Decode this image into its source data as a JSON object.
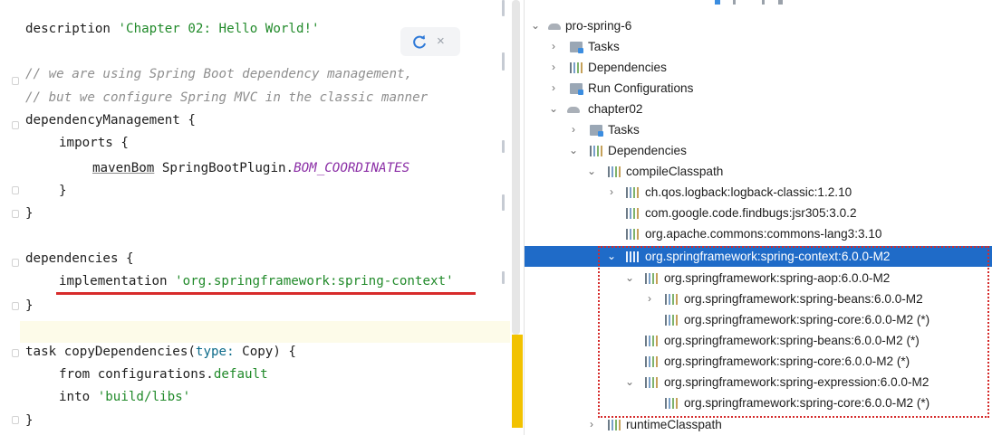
{
  "editor": {
    "lines": {
      "l1": {
        "kw": "description",
        "str": "'Chapter 02: Hello World!'"
      },
      "l3": "// we are using Spring Boot dependency management,",
      "l4": "// but we configure Spring MVC in the classic manner",
      "l5": {
        "a": "dependencyManagement",
        "b": " {"
      },
      "l6": {
        "a": "imports",
        "b": " {"
      },
      "l7": {
        "a": "mavenBom",
        "b": " SpringBootPlugin.",
        "c": "BOM_COORDINATES"
      },
      "l8": "}",
      "l9": "}",
      "l11": {
        "a": "dependencies",
        "b": " {"
      },
      "l12": {
        "a": "implementation",
        "b": " ",
        "c": "'org.springframework:spring-context'"
      },
      "l13": "}",
      "l15": {
        "a": "task",
        "b": " copyDependencies(",
        "c": "type:",
        "d": " Copy) {"
      },
      "l16": {
        "a": "from",
        "b": " configurations.",
        "c": "default"
      },
      "l17": {
        "a": "into",
        "b": " ",
        "c": "'build/libs'"
      },
      "l18": "}"
    },
    "reload_icon": "reload-icon",
    "close_label": "×"
  },
  "tree": {
    "rows": [
      {
        "label": "pro-spring-6",
        "icon": "project-icon"
      },
      {
        "label": "Tasks",
        "icon": "tasks-folder-icon"
      },
      {
        "label": "Dependencies",
        "icon": "dependencies-icon"
      },
      {
        "label": "Run Configurations",
        "icon": "run-configurations-icon"
      },
      {
        "label": "chapter02",
        "icon": "module-icon"
      },
      {
        "label": "Tasks",
        "icon": "tasks-folder-icon"
      },
      {
        "label": "Dependencies",
        "icon": "dependencies-icon"
      },
      {
        "label": "compileClasspath",
        "icon": "configuration-icon"
      },
      {
        "label": "ch.qos.logback:logback-classic:1.2.10",
        "icon": "library-icon"
      },
      {
        "label": "com.google.code.findbugs:jsr305:3.0.2",
        "icon": "library-icon"
      },
      {
        "label": "org.apache.commons:commons-lang3:3.10",
        "icon": "library-icon"
      },
      {
        "label": "org.springframework:spring-context:6.0.0-M2",
        "icon": "library-icon"
      },
      {
        "label": "org.springframework:spring-aop:6.0.0-M2",
        "icon": "library-icon"
      },
      {
        "label": "org.springframework:spring-beans:6.0.0-M2",
        "icon": "library-icon"
      },
      {
        "label": "org.springframework:spring-core:6.0.0-M2 (*)",
        "icon": "library-icon"
      },
      {
        "label": "org.springframework:spring-beans:6.0.0-M2 (*)",
        "icon": "library-icon"
      },
      {
        "label": "org.springframework:spring-core:6.0.0-M2 (*)",
        "icon": "library-icon"
      },
      {
        "label": "org.springframework:spring-expression:6.0.0-M2",
        "icon": "library-icon"
      },
      {
        "label": "org.springframework:spring-core:6.0.0-M2 (*)",
        "icon": "library-icon"
      },
      {
        "label": "runtimeClasspath",
        "icon": "configuration-icon"
      }
    ],
    "chevron_collapsed": "›",
    "chevron_expanded": "⌄"
  },
  "colors": {
    "selection": "#1f6bc8",
    "highlight_box": "#d52b2b",
    "string": "#218a2a",
    "keyword": "#0d3a8c"
  }
}
